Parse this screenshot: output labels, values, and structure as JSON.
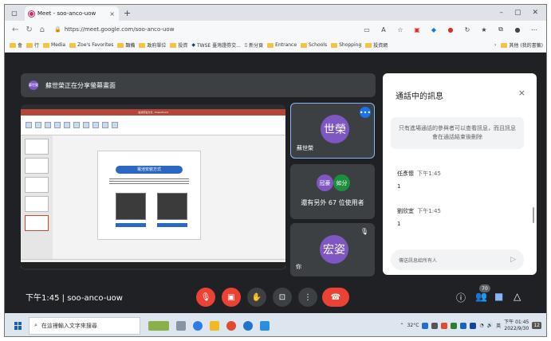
{
  "browser": {
    "tab_title": "Meet - soo-anco-uow",
    "url": "https://meet.google.com/soo-anco-uow",
    "new_tab_symbol": "+",
    "tab_close": "×",
    "win_minimize": "–",
    "win_maximize": "▢",
    "win_close": "✕"
  },
  "bookmarks": {
    "items": [
      "會",
      "行",
      "Media",
      "Zoe's Favorites",
      "類備",
      "政府單位",
      "投資",
      "TWSE 臺灣證券交...",
      "新分頁",
      "Entrance",
      "Schools",
      "Shopping",
      "投資網"
    ],
    "more": "›",
    "other": "其他 (我的書籤)"
  },
  "meet": {
    "presenter_banner": "蘇世榮正在分享螢幕畫面",
    "banner_avatar": "蘇世榮",
    "ppt_title": "電池安裝方式 - PowerPoint",
    "slide_title": "電池安裝方式",
    "tiles": {
      "tile1_avatar": "世榮",
      "tile1_name": "蘇世榮",
      "tile1_more": "•••",
      "tile2_av1": "冠豪",
      "tile2_av2": "如分",
      "tile2_others": "還有另外 67 位使用者",
      "tile3_avatar": "宏姿",
      "tile3_name": "你",
      "tile3_mic": "🎙"
    },
    "meeting_time": "下午1:45",
    "meeting_code": "soo-anco-uow",
    "people_count": "70"
  },
  "chat": {
    "title": "通話中的訊息",
    "close": "×",
    "info": "只有進場通話的參與者可以查看訊息，而且訊息會在通話結束後刪除",
    "messages": [
      {
        "sender": "任彥懷",
        "time": "下午1:45",
        "text": "1"
      },
      {
        "sender": "劉欣宜",
        "time": "下午1:45",
        "text": "1"
      }
    ],
    "input_placeholder": "傳送訊息給所有人",
    "send": "▷"
  },
  "taskbar": {
    "search_placeholder": "在這裡輸入文字來搜尋",
    "weather": "32°C",
    "ime": "英",
    "time": "下午 01:45",
    "date": "2022/9/30",
    "notif_count": "12"
  },
  "colors": {
    "meet_bg": "#202124",
    "tile_bg": "#3c4043",
    "red": "#ea4335",
    "avatar_purple": "#7e57c2",
    "accent_blue": "#1a73e8"
  }
}
